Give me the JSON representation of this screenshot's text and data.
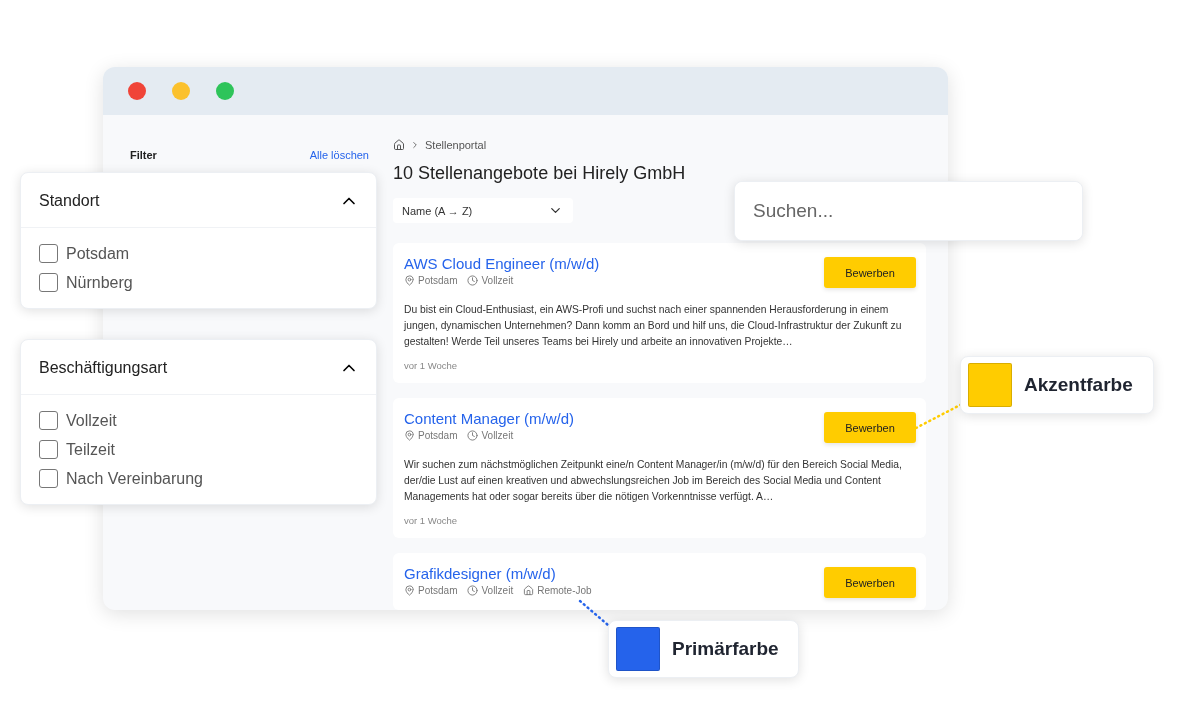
{
  "sidebar": {
    "title": "Filter",
    "clear_link": "Alle löschen"
  },
  "breadcrumb": [
    "Stellenportal"
  ],
  "heading": "10 Stellenangebote bei Hirely GmbH",
  "sort": {
    "value": "Name (A → Z)"
  },
  "jobs": [
    {
      "title": "AWS Cloud Engineer (m/w/d)",
      "tags": [
        {
          "kind": "location",
          "text": "Potsdam"
        },
        {
          "kind": "time",
          "text": "Vollzeit"
        }
      ],
      "description": "Du bist ein Cloud-Enthusiast, ein AWS-Profi und suchst nach einer spannenden Herausforderung in einem jungen, dynamischen Unternehmen? Dann komm an Bord und hilf uns, die Cloud-Infrastruktur der Zukunft zu gestalten! Werde Teil unseres Teams bei Hirely und arbeite an innovativen Projekte…",
      "age": "vor 1 Woche",
      "button": "Bewerben"
    },
    {
      "title": "Content Manager (m/w/d)",
      "tags": [
        {
          "kind": "location",
          "text": "Potsdam"
        },
        {
          "kind": "time",
          "text": "Vollzeit"
        }
      ],
      "description": "Wir suchen zum nächstmöglichen Zeitpunkt eine/n Content Manager/in (m/w/d) für den Bereich Social Media, der/die Lust auf einen kreativen und abwechslungsreichen Job im Bereich des Social Media und Content Managements hat oder sogar bereits über die nötigen Vorkenntnisse verfügt. A…",
      "age": "vor 1 Woche",
      "button": "Bewerben"
    },
    {
      "title": "Grafikdesigner (m/w/d)",
      "tags": [
        {
          "kind": "location",
          "text": "Potsdam"
        },
        {
          "kind": "time",
          "text": "Vollzeit"
        },
        {
          "kind": "remote",
          "text": "Remote-Job"
        }
      ],
      "button": "Bewerben"
    }
  ],
  "filter_panels": [
    {
      "title": "Standort",
      "expanded": true,
      "options": [
        {
          "label": "Potsdam",
          "checked": false
        },
        {
          "label": "Nürnberg",
          "checked": false
        }
      ]
    },
    {
      "title": "Beschäftigungsart",
      "expanded": true,
      "options": [
        {
          "label": "Vollzeit",
          "checked": false
        },
        {
          "label": "Teilzeit",
          "checked": false
        },
        {
          "label": "Nach Vereinbarung",
          "checked": false
        }
      ]
    }
  ],
  "search": {
    "placeholder": "Suchen..."
  },
  "color_callouts": [
    {
      "label": "Akzentfarbe",
      "color": "#ffcc00"
    },
    {
      "label": "Primärfarbe",
      "color": "#2563eb"
    }
  ]
}
